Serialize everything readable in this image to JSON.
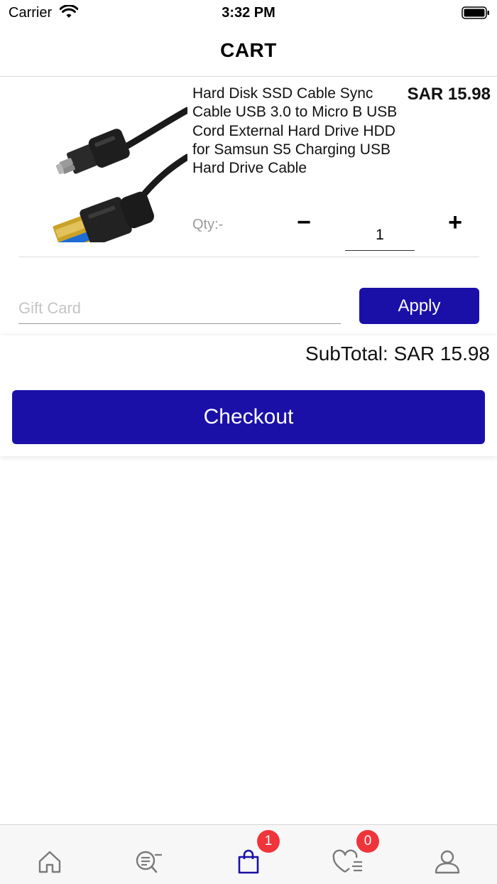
{
  "status_bar": {
    "carrier": "Carrier",
    "time": "3:32 PM"
  },
  "header": {
    "title": "CART"
  },
  "cart": {
    "items": [
      {
        "name": "Hard Disk SSD Cable Sync Cable USB 3.0 to Micro B USB Cord External Hard Drive HDD for Samsun S5 Charging USB Hard Drive Cable",
        "price": "SAR 15.98",
        "qty_label": "Qty:-",
        "qty_value": "1",
        "minus_label": "−",
        "plus_label": "+"
      }
    ]
  },
  "gift_card": {
    "placeholder": "Gift Card",
    "value": "",
    "apply_label": "Apply"
  },
  "summary": {
    "subtotal": "SubTotal: SAR 15.98",
    "checkout_label": "Checkout"
  },
  "tab_bar": {
    "tabs": [
      {
        "icon": "home-icon"
      },
      {
        "icon": "search-list-icon"
      },
      {
        "icon": "shopping-bag-icon",
        "badge": "1",
        "active": true
      },
      {
        "icon": "heart-list-icon",
        "badge": "0"
      },
      {
        "icon": "user-icon"
      }
    ],
    "active_color": "#1a10a8",
    "inactive_color": "#7a7a7a",
    "badge_color": "#f0343b"
  },
  "colors": {
    "accent": "#1a10a8"
  }
}
